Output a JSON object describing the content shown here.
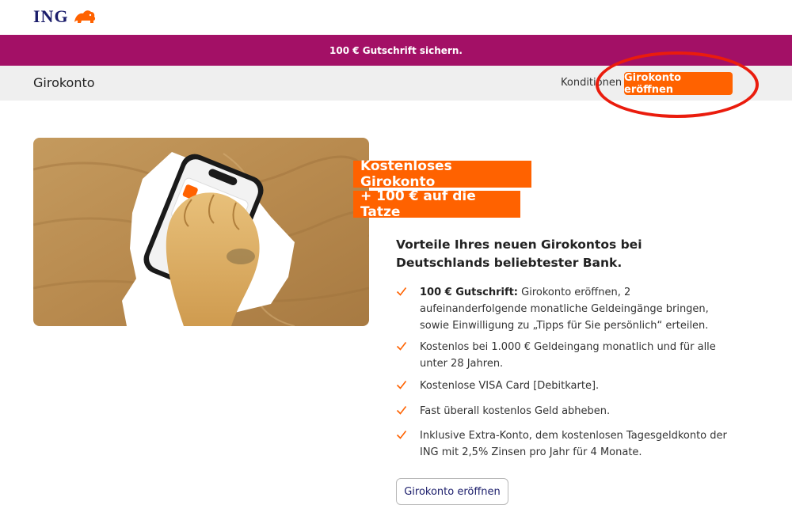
{
  "brand": {
    "logo_text": "ING",
    "logo_icon": "lion-icon",
    "primary_color": "#ff6200",
    "promo_color": "#a31066",
    "navy": "#1b1d6b"
  },
  "promo_banner": {
    "text": "100 € Gutschrift sichern."
  },
  "subnav": {
    "title": "Girokonto",
    "link": "Konditionen",
    "cta": "Girokonto eröffnen"
  },
  "hero": {
    "image_icon": "lion-paw-phone-image",
    "badges": [
      "Kostenloses Girokonto",
      "+ 100 € auf die Tatze"
    ]
  },
  "main": {
    "headline": "Vorteile Ihres neuen Girokontos bei Deutschlands beliebtester Bank.",
    "benefits": [
      {
        "bold": "100 € Gutschrift:",
        "text": " Girokonto eröffnen, 2 aufeinanderfolgende monatliche Geldeingänge bringen, sowie Einwilligung zu „Tipps für Sie persönlich“ erteilen."
      },
      {
        "bold": "",
        "text": "Kostenlos bei 1.000 € Geldeingang monatlich und für alle unter 28 Jahren."
      },
      {
        "bold": "",
        "text": "Kostenlose VISA Card [Debitkarte]."
      },
      {
        "bold": "",
        "text": "Fast überall kostenlos Geld abheben."
      },
      {
        "bold": "",
        "text": "Inklusive Extra-Konto, dem kostenlosen Tagesgeldkonto der ING mit 2,5% Zinsen pro Jahr für 4 Monate."
      }
    ],
    "cta": "Girokonto eröffnen"
  }
}
